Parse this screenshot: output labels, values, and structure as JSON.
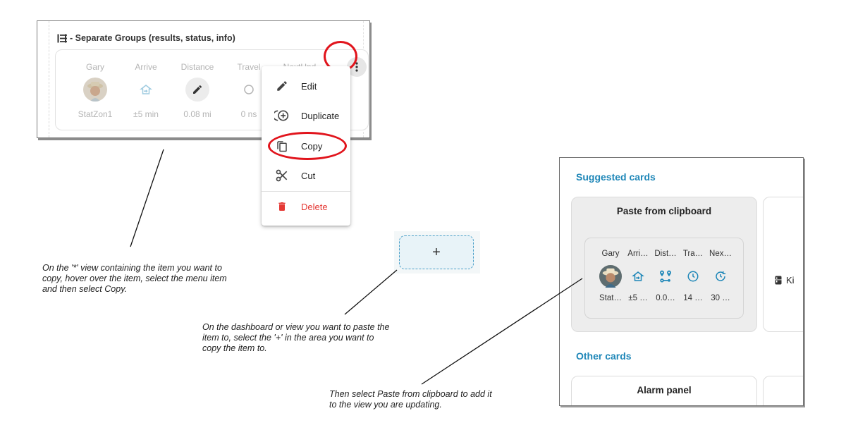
{
  "shot1": {
    "title": "- Separate Groups (results, status, info)",
    "entities": [
      {
        "header": "Gary",
        "value": "StatZon1",
        "icon": "person-avatar"
      },
      {
        "header": "Arrive",
        "value": "±5 min",
        "icon": "home-import-icon"
      },
      {
        "header": "Distance",
        "value": "0.08 mi",
        "icon": "pencil-icon"
      },
      {
        "header": "Travel",
        "value": "0 ns",
        "icon": "clock-icon"
      },
      {
        "header": "NextUpd",
        "value": "",
        "icon": "update-icon"
      }
    ]
  },
  "menu": {
    "items": [
      {
        "label": "Edit",
        "icon": "pencil-icon"
      },
      {
        "label": "Duplicate",
        "icon": "duplicate-icon"
      },
      {
        "label": "Copy",
        "icon": "copy-icon"
      },
      {
        "label": "Cut",
        "icon": "scissors-icon"
      },
      {
        "label": "Delete",
        "icon": "trash-icon"
      }
    ],
    "delete_color": "#e53935"
  },
  "plus": {
    "label": "+"
  },
  "panel": {
    "suggested_title": "Suggested cards",
    "paste_title": "Paste from clipboard",
    "mini_entities": [
      {
        "header": "Gary",
        "value": "Stat…",
        "icon": "person-avatar"
      },
      {
        "header": "Arri…",
        "value": "±5 …",
        "icon": "home-import-icon"
      },
      {
        "header": "Dist…",
        "value": "0.0…",
        "icon": "map-marker-distance-icon"
      },
      {
        "header": "Tra…",
        "value": "14 …",
        "icon": "clock-icon"
      },
      {
        "header": "Nex…",
        "value": "30 …",
        "icon": "update-icon"
      }
    ],
    "side_tile_label": "Ki",
    "other_title": "Other cards",
    "alarm_title": "Alarm panel",
    "accent": "#1f87b8"
  },
  "captions": {
    "copy_step": "On the '*' view containing the item you want to copy, hover over the item, select the menu item and then select Copy.",
    "plus_step": "On the dashboard or view you want to paste the item to, select the '+' in the area you want to copy the item to.",
    "paste_step": "Then select Paste from clipboard to add it to the view you are updating."
  },
  "colors": {
    "highlight_ring": "#e1141c",
    "icon_blue": "#1f87b8"
  }
}
